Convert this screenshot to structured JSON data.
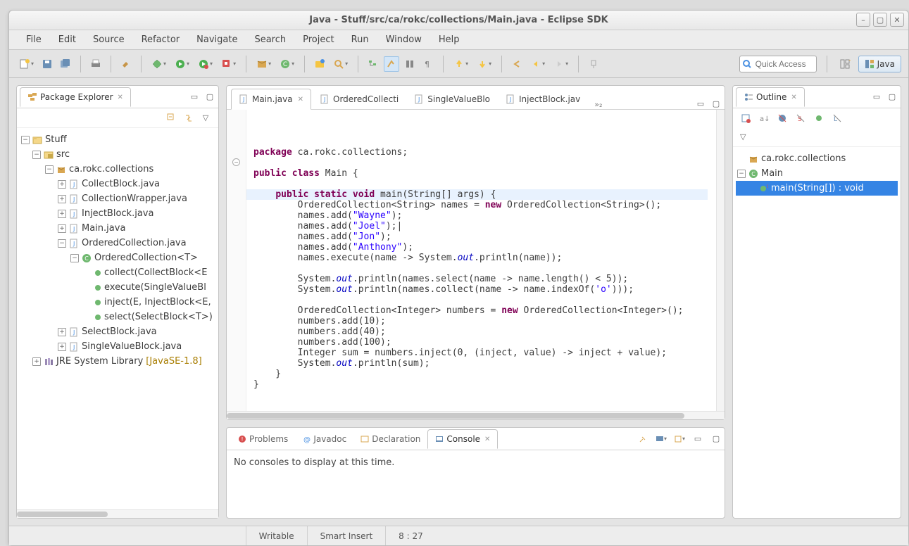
{
  "window": {
    "title": "Java - Stuff/src/ca/rokc/collections/Main.java - Eclipse SDK"
  },
  "menubar": [
    "File",
    "Edit",
    "Source",
    "Refactor",
    "Navigate",
    "Search",
    "Project",
    "Run",
    "Window",
    "Help"
  ],
  "quickaccess_placeholder": "Quick Access",
  "perspective": {
    "label": "Java"
  },
  "package_explorer": {
    "title": "Package Explorer",
    "nodes": {
      "project": "Stuff",
      "src": "src",
      "pkg": "ca.rokc.collections",
      "cu1": "CollectBlock.java",
      "cu2": "CollectionWrapper.java",
      "cu3": "InjectBlock.java",
      "cu4": "Main.java",
      "cu5": "OrderedCollection.java",
      "cls": "OrderedCollection<T>",
      "m1": "collect(CollectBlock<E",
      "m2": "execute(SingleValueBl",
      "m3": "inject(E, InjectBlock<E,",
      "m4": "select(SelectBlock<T>)",
      "cu6": "SelectBlock.java",
      "cu7": "SingleValueBlock.java",
      "jre": "JRE System Library",
      "jre_suffix": " [JavaSE-1.8]"
    }
  },
  "editor": {
    "tabs": [
      "Main.java",
      "OrderedCollecti",
      "SingleValueBlo",
      "InjectBlock.jav"
    ],
    "overflow": "»₂"
  },
  "outline": {
    "title": "Outline",
    "pkg": "ca.rokc.collections",
    "class": "Main",
    "method": "main(String[]) : void"
  },
  "bottom_tabs": [
    "Problems",
    "Javadoc",
    "Declaration",
    "Console"
  ],
  "console_msg": "No consoles to display at this time.",
  "status": {
    "writable": "Writable",
    "insert": "Smart Insert",
    "pos": "8 : 27"
  },
  "code_lines": [
    {
      "k": "kw",
      "t": "package"
    },
    {
      "k": "p",
      "t": " ca.rokc.collections;"
    },
    {
      "k": "nl"
    },
    {
      "k": "nl"
    },
    {
      "k": "kw",
      "t": "public class"
    },
    {
      "k": "p",
      "t": " Main {"
    },
    {
      "k": "nl"
    },
    {
      "k": "nl"
    },
    {
      "k": "sp",
      "t": "    "
    },
    {
      "k": "kw",
      "t": "public static void"
    },
    {
      "k": "p",
      "t": " main(String[] args) {"
    },
    {
      "k": "nl"
    },
    {
      "k": "sp",
      "t": "        "
    },
    {
      "k": "p",
      "t": "OrderedCollection<String> names = "
    },
    {
      "k": "kw",
      "t": "new"
    },
    {
      "k": "p",
      "t": " OrderedCollection<String>();"
    },
    {
      "k": "nl"
    },
    {
      "k": "sp",
      "t": "        "
    },
    {
      "k": "p",
      "t": "names.add("
    },
    {
      "k": "str",
      "t": "\"Wayne\""
    },
    {
      "k": "p",
      "t": ");"
    },
    {
      "k": "nl"
    },
    {
      "k": "sp",
      "t": "        "
    },
    {
      "k": "p",
      "t": "names.add("
    },
    {
      "k": "str",
      "t": "\"Joel\""
    },
    {
      "k": "p",
      "t": ");|"
    },
    {
      "k": "nl"
    },
    {
      "k": "sp",
      "t": "        "
    },
    {
      "k": "p",
      "t": "names.add("
    },
    {
      "k": "str",
      "t": "\"Jon\""
    },
    {
      "k": "p",
      "t": ");"
    },
    {
      "k": "nl"
    },
    {
      "k": "sp",
      "t": "        "
    },
    {
      "k": "p",
      "t": "names.add("
    },
    {
      "k": "str",
      "t": "\"Anthony\""
    },
    {
      "k": "p",
      "t": ");"
    },
    {
      "k": "nl"
    },
    {
      "k": "sp",
      "t": "        "
    },
    {
      "k": "p",
      "t": "names.execute(name -> System."
    },
    {
      "k": "fld",
      "t": "out"
    },
    {
      "k": "p",
      "t": ".println(name));"
    },
    {
      "k": "nl"
    },
    {
      "k": "nl"
    },
    {
      "k": "sp",
      "t": "        "
    },
    {
      "k": "p",
      "t": "System."
    },
    {
      "k": "fld",
      "t": "out"
    },
    {
      "k": "p",
      "t": ".println(names.select(name -> name.length() < 5));"
    },
    {
      "k": "nl"
    },
    {
      "k": "sp",
      "t": "        "
    },
    {
      "k": "p",
      "t": "System."
    },
    {
      "k": "fld",
      "t": "out"
    },
    {
      "k": "p",
      "t": ".println(names.collect(name -> name.indexOf("
    },
    {
      "k": "ch",
      "t": "'o'"
    },
    {
      "k": "p",
      "t": ")));"
    },
    {
      "k": "nl"
    },
    {
      "k": "nl"
    },
    {
      "k": "sp",
      "t": "        "
    },
    {
      "k": "p",
      "t": "OrderedCollection<Integer> numbers = "
    },
    {
      "k": "kw",
      "t": "new"
    },
    {
      "k": "p",
      "t": " OrderedCollection<Integer>();"
    },
    {
      "k": "nl"
    },
    {
      "k": "sp",
      "t": "        "
    },
    {
      "k": "p",
      "t": "numbers.add(10);"
    },
    {
      "k": "nl"
    },
    {
      "k": "sp",
      "t": "        "
    },
    {
      "k": "p",
      "t": "numbers.add(40);"
    },
    {
      "k": "nl"
    },
    {
      "k": "sp",
      "t": "        "
    },
    {
      "k": "p",
      "t": "numbers.add(100);"
    },
    {
      "k": "nl"
    },
    {
      "k": "sp",
      "t": "        "
    },
    {
      "k": "p",
      "t": "Integer sum = numbers.inject(0, (inject, value) -> inject + value);"
    },
    {
      "k": "nl"
    },
    {
      "k": "sp",
      "t": "        "
    },
    {
      "k": "p",
      "t": "System."
    },
    {
      "k": "fld",
      "t": "out"
    },
    {
      "k": "p",
      "t": ".println(sum);"
    },
    {
      "k": "nl"
    },
    {
      "k": "sp",
      "t": "    "
    },
    {
      "k": "p",
      "t": "}"
    },
    {
      "k": "nl"
    },
    {
      "k": "p",
      "t": "}"
    }
  ]
}
